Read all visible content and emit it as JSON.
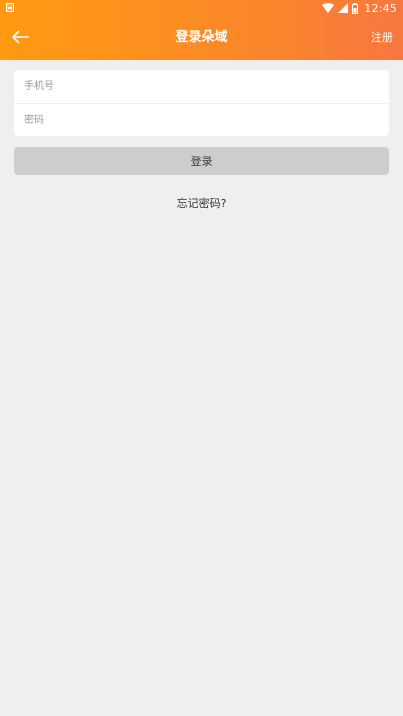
{
  "status_bar": {
    "time": "12:45",
    "icons": [
      "notification-icon",
      "wifi-icon",
      "signal-icon",
      "battery-icon"
    ]
  },
  "header": {
    "back_icon": "arrow-left-icon",
    "title": "登录朵域",
    "register_label": "注册"
  },
  "form": {
    "phone_placeholder": "手机号",
    "phone_value": "",
    "password_placeholder": "密码",
    "password_value": ""
  },
  "login_button_label": "登录",
  "forgot_password_label": "忘记密码?",
  "colors": {
    "header_gradient_start": "#ff9a12",
    "header_gradient_end": "#f7773f",
    "background": "#efefef",
    "button_disabled": "#cdcdcd"
  }
}
